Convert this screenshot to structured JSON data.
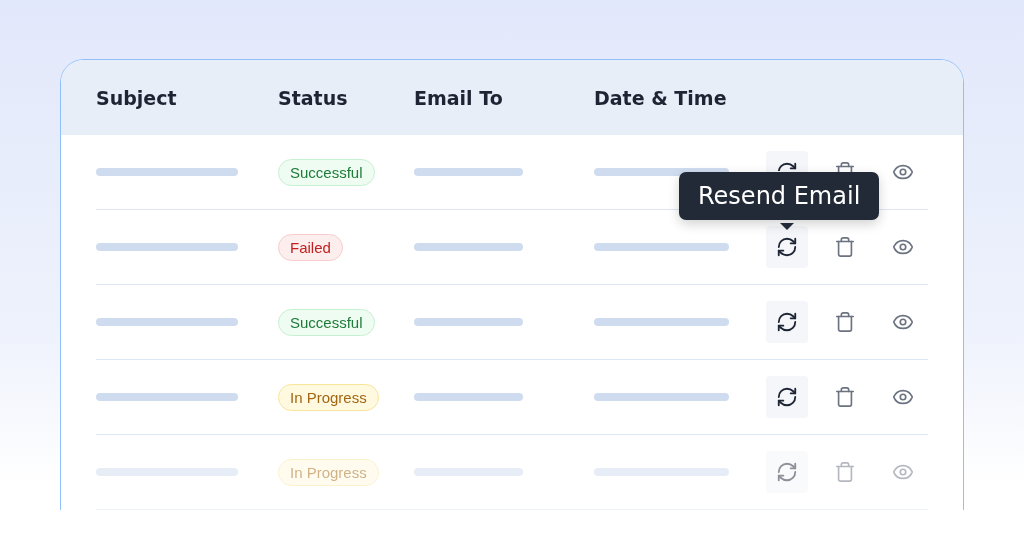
{
  "table": {
    "columns": [
      "Subject",
      "Status",
      "Email To",
      "Date & Time"
    ],
    "rows": [
      {
        "status": {
          "label": "Successful",
          "kind": "success"
        },
        "faded": false
      },
      {
        "status": {
          "label": "Failed",
          "kind": "failed"
        },
        "faded": false,
        "tooltip": "Resend Email"
      },
      {
        "status": {
          "label": "Successful",
          "kind": "success"
        },
        "faded": false
      },
      {
        "status": {
          "label": "In Progress",
          "kind": "progress"
        },
        "faded": false
      },
      {
        "status": {
          "label": "In Progress",
          "kind": "progress"
        },
        "faded": true
      }
    ]
  }
}
